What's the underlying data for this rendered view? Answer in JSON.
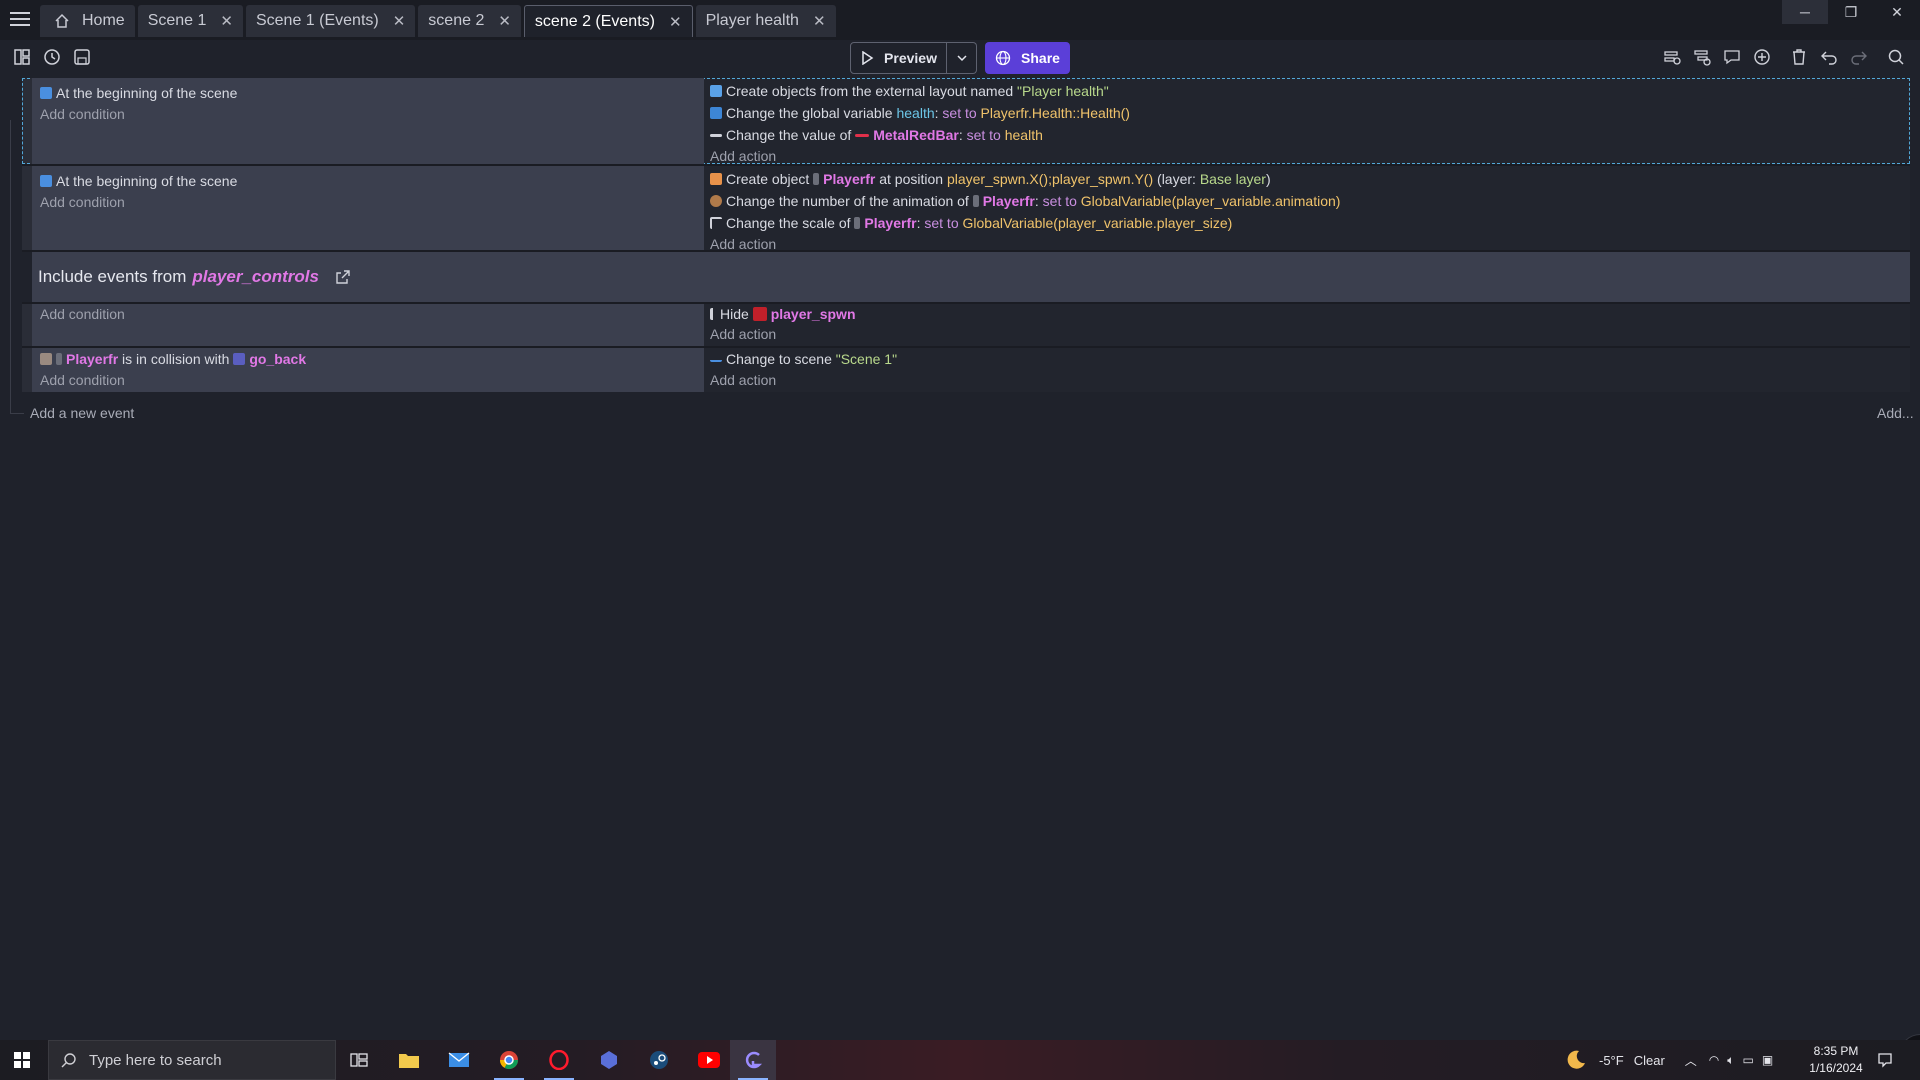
{
  "tabs": [
    {
      "label": "Home",
      "closable": false,
      "active": false
    },
    {
      "label": "Scene 1",
      "closable": true,
      "active": false
    },
    {
      "label": "Scene 1 (Events)",
      "closable": true,
      "active": false
    },
    {
      "label": "scene 2",
      "closable": true,
      "active": false
    },
    {
      "label": "scene 2 (Events)",
      "closable": true,
      "active": true
    },
    {
      "label": "Player health",
      "closable": true,
      "active": false
    }
  ],
  "toolbar": {
    "preview_label": "Preview",
    "share_label": "Share"
  },
  "events": {
    "add_condition": "Add condition",
    "add_action": "Add action",
    "e1": {
      "condition": "At the beginning of the scene",
      "a1_text": "Create objects from the external layout named",
      "a1_value": "\"Player health\"",
      "a2_text": "Change the global variable",
      "a2_var": "health",
      "a2_colon": ":",
      "a2_set": "set to",
      "a2_value": "Playerfr.Health::Health()",
      "a3_text": "Change the value of",
      "a3_obj": "MetalRedBar",
      "a3_colon": ":",
      "a3_set": "set to",
      "a3_value": "health"
    },
    "e2": {
      "condition": "At the beginning of the scene",
      "a1_text": "Create object",
      "a1_obj": "Playerfr",
      "a1_mid": "at position",
      "a1_value": "player_spwn.X();player_spwn.Y()",
      "a1_layer_open": "(layer:",
      "a1_layer": "Base layer",
      "a1_layer_close": ")",
      "a2_text": "Change the number of the animation of",
      "a2_obj": "Playerfr",
      "a2_colon": ":",
      "a2_set": "set to",
      "a2_value": "GlobalVariable(player_variable.animation)",
      "a3_text": "Change the scale of",
      "a3_obj": "Playerfr",
      "a3_colon": ":",
      "a3_set": "set to",
      "a3_value": "GlobalVariable(player_variable.player_size)"
    },
    "include": {
      "label": "Include events from",
      "link": "player_controls"
    },
    "e3": {
      "a1_text": "Hide",
      "a1_obj": "player_spwn"
    },
    "e4": {
      "c1_obj": "Playerfr",
      "c1_mid": "is in collision with",
      "c1_obj2": "go_back",
      "a1_text": "Change to scene",
      "a1_value": "\"Scene 1\""
    },
    "add_event": "Add a new event",
    "add_more": "Add..."
  },
  "taskbar": {
    "search_placeholder": "Type here to search",
    "weather_temp": "-5°F",
    "weather_desc": "Clear",
    "time": "8:35 PM",
    "date": "1/16/2024"
  },
  "colors": {
    "accent": "#5b3fd8",
    "object_name": "#e178e6",
    "value": "#f0c36b",
    "string": "#b9d98c",
    "condition_bg": "#3b3f4e"
  }
}
